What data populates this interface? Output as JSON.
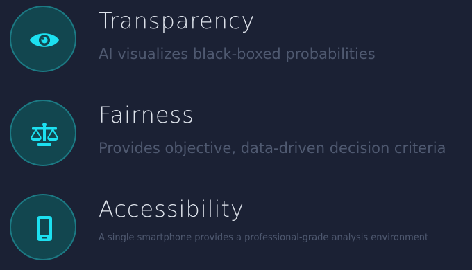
{
  "accent_color": "#1ce0f0",
  "features": [
    {
      "icon": "eye-icon",
      "title": "Transparency",
      "description": "AI visualizes black-boxed probabilities"
    },
    {
      "icon": "balance-scale-icon",
      "title": "Fairness",
      "description": "Provides objective, data-driven decision criteria"
    },
    {
      "icon": "smartphone-icon",
      "title": "Accessibility",
      "description": "A single smartphone provides a professional-grade analysis environment"
    }
  ]
}
